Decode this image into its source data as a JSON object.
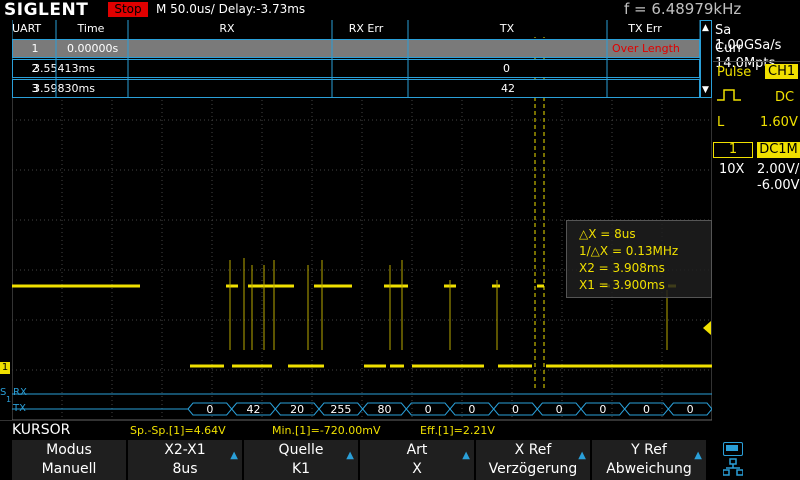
{
  "header": {
    "logo": "SIGLENT",
    "run_state": "Stop",
    "timebase": "M 50.0us/  Delay:-3.73ms",
    "frequency": "f = 6.48979kHz"
  },
  "acquisition": {
    "sample_rate": "Sa 1.00GSa/s",
    "memory_depth": "Curr 14.0Mpts"
  },
  "trigger": {
    "type": "Pulse",
    "source": "CH1",
    "coupling": "DC",
    "level_label": "L",
    "level": "1.60V"
  },
  "channel1": {
    "number": "1",
    "coupling": "DC1M",
    "probe": "10X",
    "scale": "2.00V/",
    "offset": "-6.00V"
  },
  "decode_table": {
    "columns": [
      "UART",
      "Time",
      "RX",
      "RX Err",
      "TX",
      "TX Err"
    ],
    "rows": [
      {
        "index": "1",
        "time": "0.00000s",
        "rx": "",
        "rx_err": "",
        "tx": "",
        "tx_err": "Over Length"
      },
      {
        "index": "2",
        "time": "3.55413ms",
        "rx": "",
        "rx_err": "",
        "tx": "0",
        "tx_err": ""
      },
      {
        "index": "3",
        "time": "3.59830ms",
        "rx": "",
        "rx_err": "",
        "tx": "42",
        "tx_err": ""
      }
    ]
  },
  "cursor_box": {
    "dx": "△X = 8us",
    "inv_dx": "1/△X = 0.13MHz",
    "x2": "X2 = 3.908ms",
    "x1": "X1 = 3.900ms"
  },
  "bus": {
    "label_s": "S",
    "label_num": "1",
    "rx_label": "RX",
    "tx_label": "TX",
    "tx_values": [
      "0",
      "42",
      "20",
      "255",
      "80",
      "0",
      "0",
      "0",
      "0",
      "0",
      "0",
      "0"
    ]
  },
  "measurements": {
    "title": "KURSOR",
    "pkpk": "Sp.-Sp.[1]=4.64V",
    "min": "Min.[1]=-720.00mV",
    "rms": "Eff.[1]=2.21V"
  },
  "softkeys": [
    {
      "l1": "Modus",
      "l2": "Manuell",
      "arrow": false
    },
    {
      "l1": "X2-X1",
      "l2": "8us",
      "arrow": true
    },
    {
      "l1": "Quelle",
      "l2": "K1",
      "arrow": true
    },
    {
      "l1": "Art",
      "l2": "X",
      "arrow": true
    },
    {
      "l1": "X Ref",
      "l2": "Verzögerung",
      "arrow": true
    },
    {
      "l1": "Y Ref",
      "l2": "Abweichung",
      "arrow": true
    }
  ],
  "colors": {
    "ch1": "#f0e000",
    "accent": "#2a9fd8",
    "stop": "#e00000",
    "error": "#e00000"
  }
}
